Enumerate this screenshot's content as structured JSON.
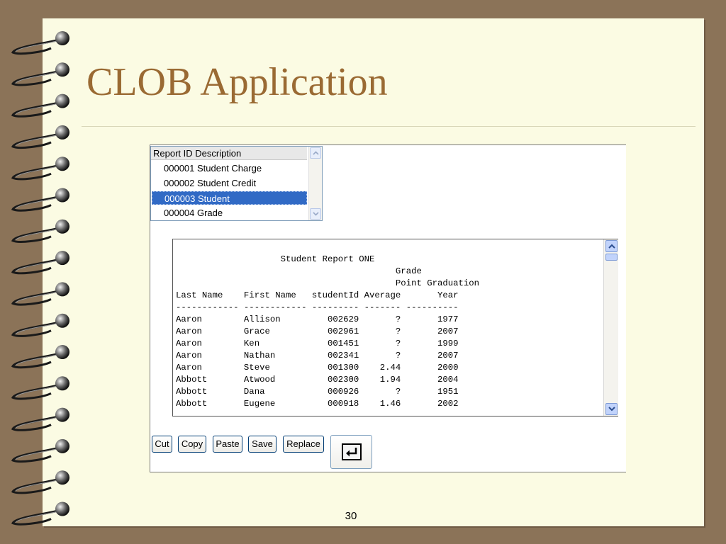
{
  "slide": {
    "title": "CLOB Application",
    "page_number": "30"
  },
  "report_list": {
    "header": "Report ID Description",
    "items": [
      {
        "label": "000001 Student Charge",
        "selected": false
      },
      {
        "label": "000002 Student Credit",
        "selected": false
      },
      {
        "label": "000003 Student",
        "selected": true
      },
      {
        "label": "000004 Grade",
        "selected": false
      }
    ]
  },
  "report": {
    "lines": [
      "                    Student Report ONE",
      "                                          Grade",
      "                                          Point Graduation",
      "Last Name    First Name   studentId Average       Year",
      "------------ ------------ --------- ------- ----------",
      "Aaron        Allison         002629       ?       1977",
      "Aaron        Grace           002961       ?       2007",
      "Aaron        Ken             001451       ?       1999",
      "Aaron        Nathan          002341       ?       2007",
      "Aaron        Steve           001300    2.44       2000",
      "Abbott       Atwood          002300    1.94       2004",
      "Abbott       Dana            000926       ?       1951",
      "Abbott       Eugene          000918    1.46       2002"
    ]
  },
  "toolbar": {
    "cut": "Cut",
    "copy": "Copy",
    "paste": "Paste",
    "save": "Save",
    "replace": "Replace",
    "undo_icon": "return-arrow-icon"
  },
  "colors": {
    "background": "#8b7358",
    "page": "#fbfbe3",
    "title": "#9a6a33",
    "selection": "#316ac5"
  }
}
